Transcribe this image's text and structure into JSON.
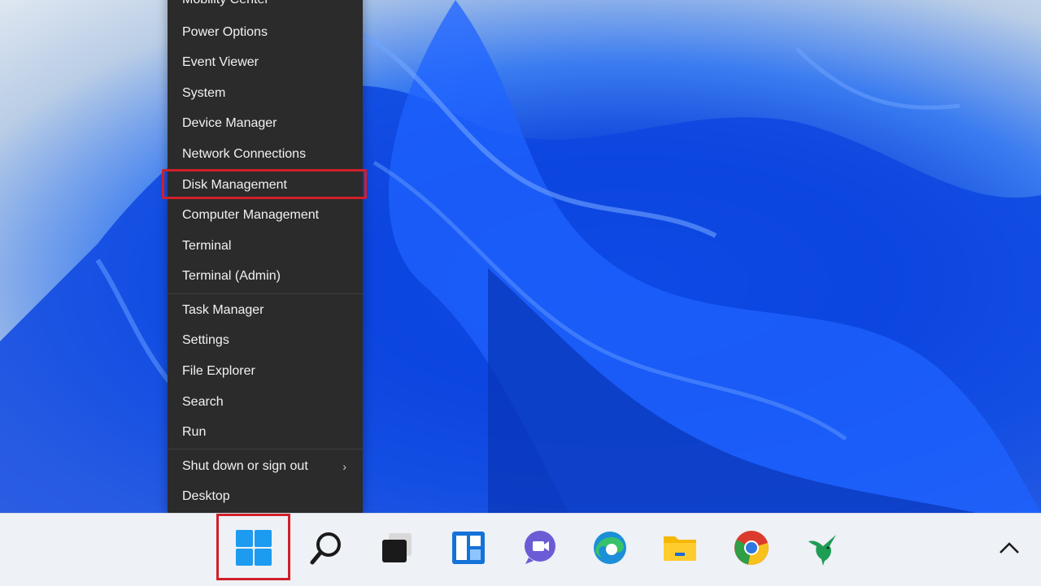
{
  "context_menu": {
    "items": [
      {
        "label": "Mobility Center"
      },
      {
        "label": "Power Options"
      },
      {
        "label": "Event Viewer"
      },
      {
        "label": "System"
      },
      {
        "label": "Device Manager"
      },
      {
        "label": "Network Connections"
      },
      {
        "label": "Disk Management",
        "highlighted": true
      },
      {
        "label": "Computer Management"
      },
      {
        "label": "Terminal"
      },
      {
        "label": "Terminal (Admin)"
      },
      {
        "label": "Task Manager"
      },
      {
        "label": "Settings"
      },
      {
        "label": "File Explorer"
      },
      {
        "label": "Search"
      },
      {
        "label": "Run"
      },
      {
        "label": "Shut down or sign out",
        "has_submenu": true
      },
      {
        "label": "Desktop"
      }
    ],
    "submenu_glyph": "›"
  },
  "taskbar": {
    "icons": [
      "windows-start-icon",
      "search-icon",
      "task-view-icon",
      "widgets-icon",
      "teams-chat-icon",
      "edge-icon",
      "file-explorer-icon",
      "chrome-icon",
      "hummingbird-app-icon"
    ],
    "overflow_glyph": "⌃"
  },
  "colors": {
    "menu_bg": "#2b2b2b",
    "highlight": "#d0202a",
    "taskbar_bg": "#eef1f6",
    "accent": "#0a6fd8"
  }
}
